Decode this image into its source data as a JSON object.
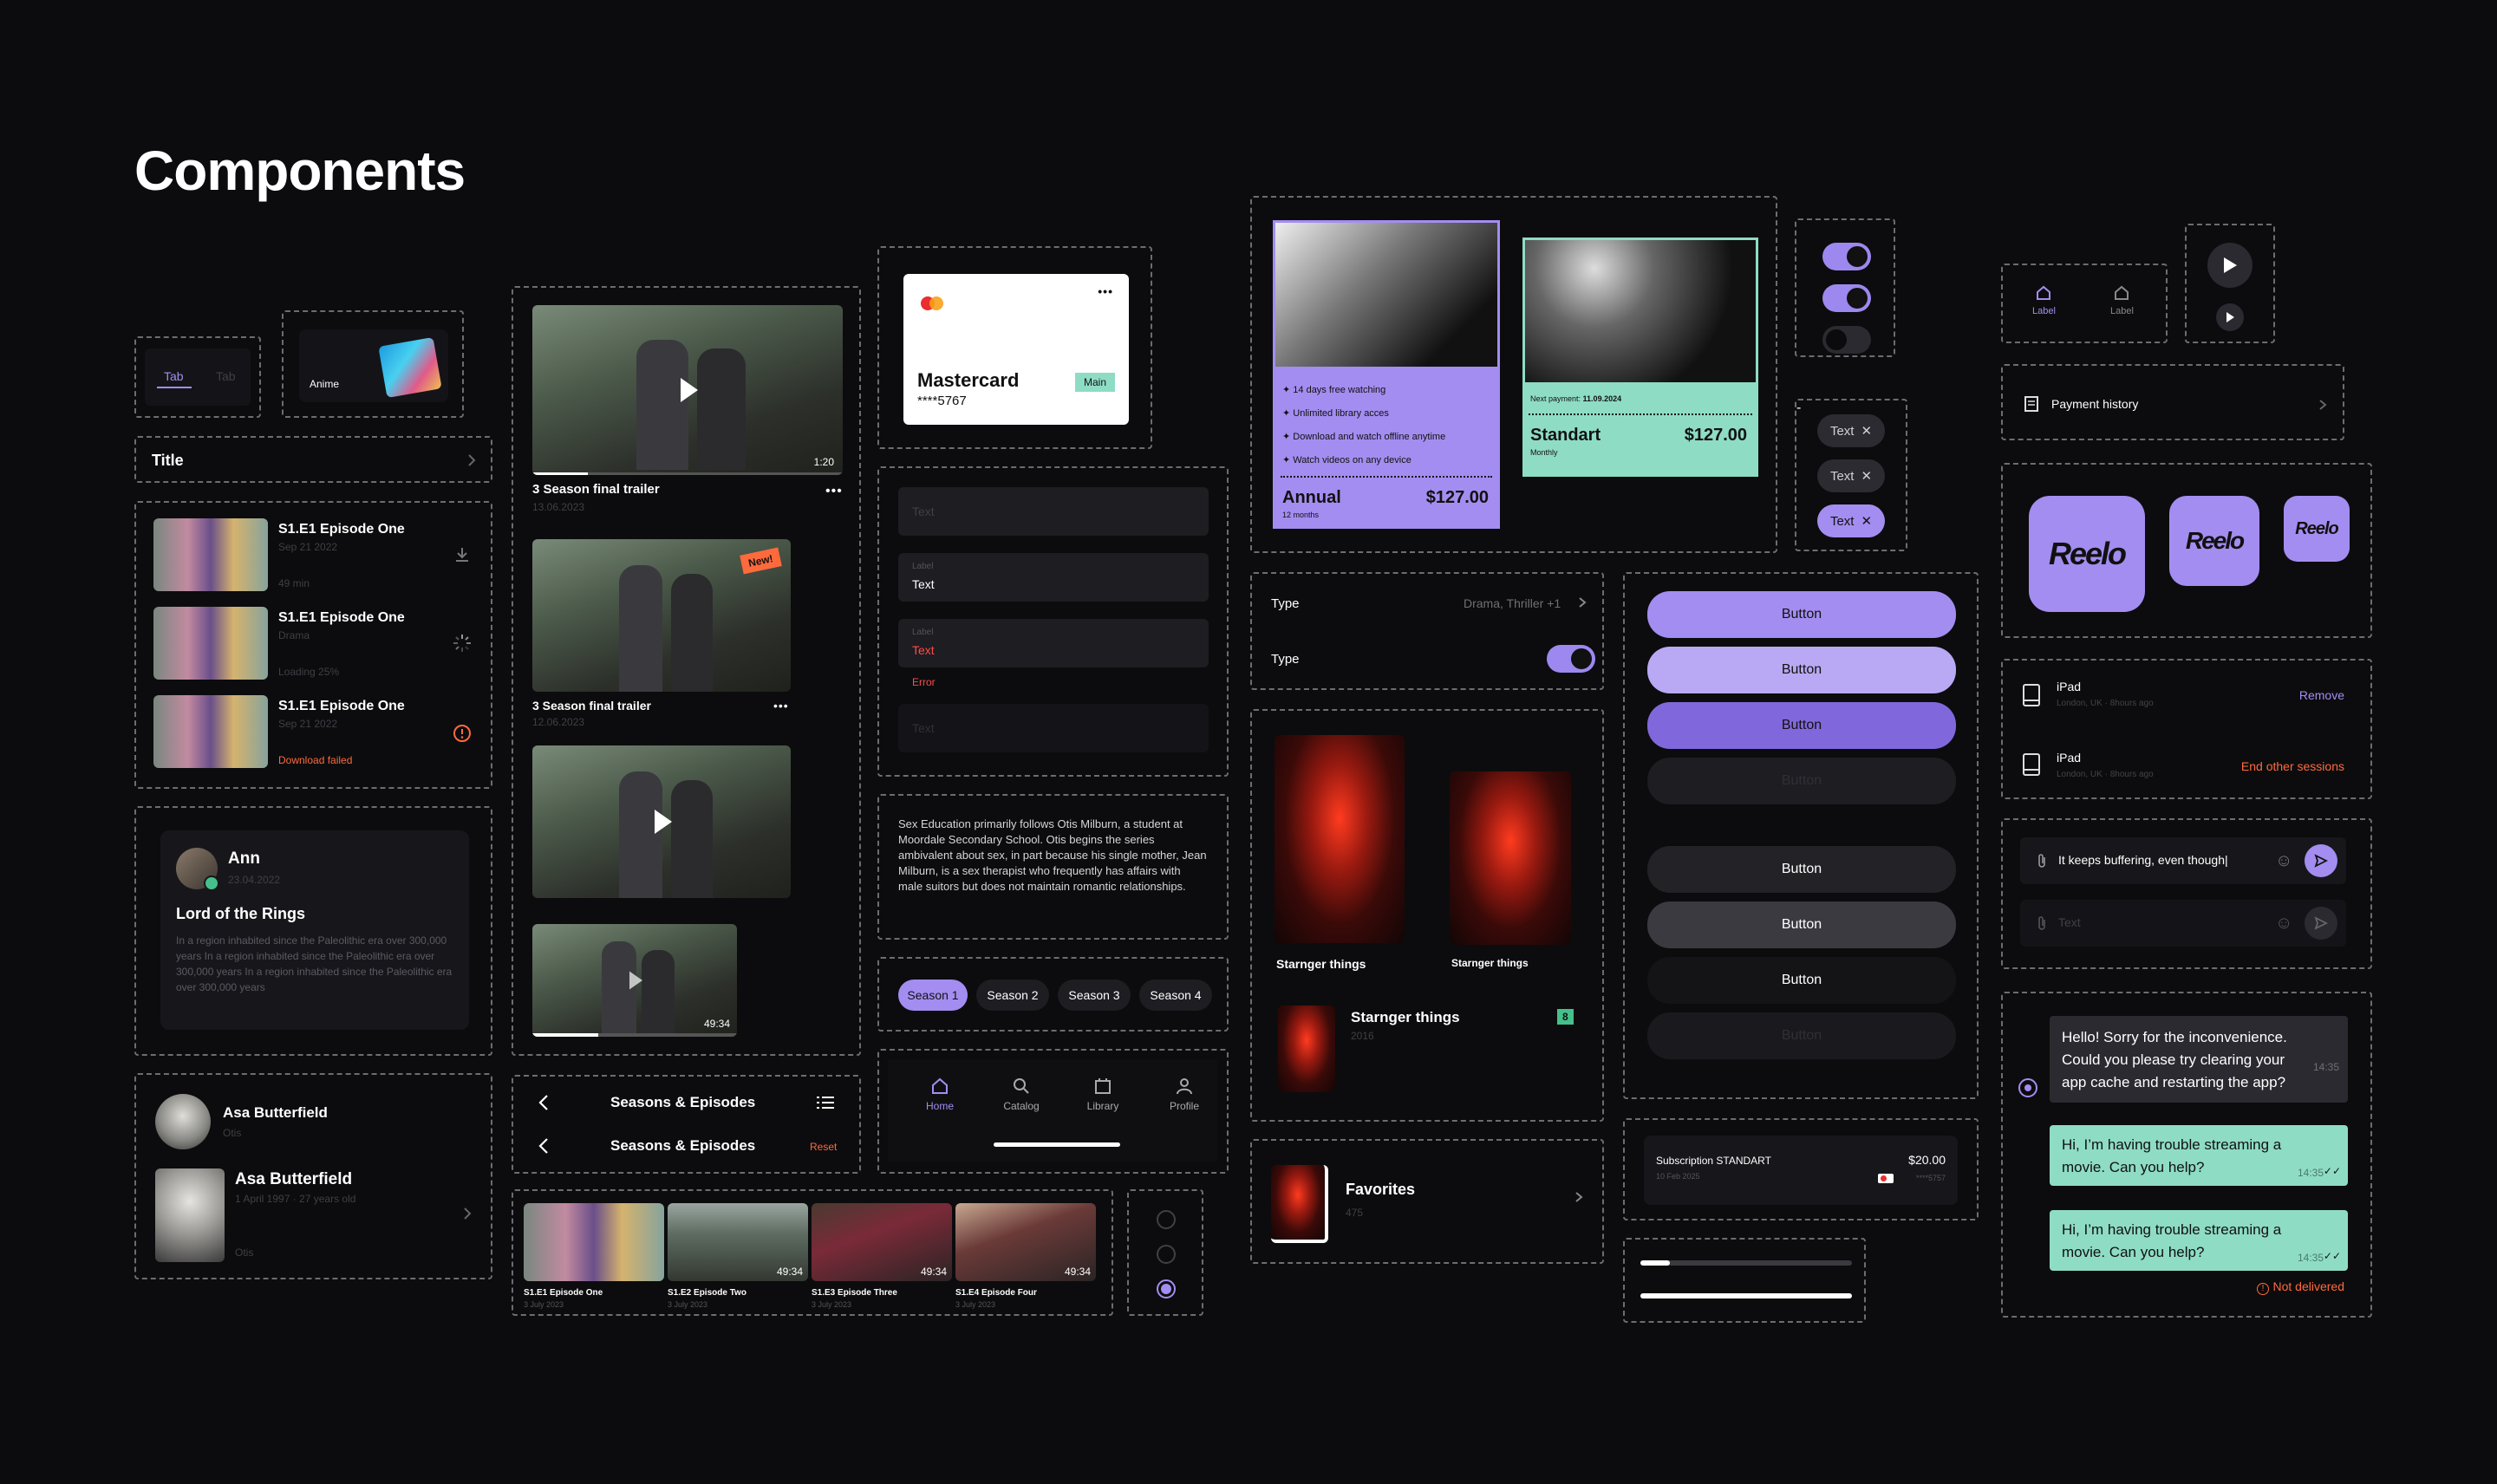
{
  "page": {
    "title": "Components"
  },
  "tabs": {
    "active": "Tab",
    "inactive": "Tab"
  },
  "category_card": {
    "label": "Anime"
  },
  "title_row": {
    "label": "Title"
  },
  "downloads": [
    {
      "title": "S1.E1 Episode One",
      "sub": "Sep 21 2022",
      "meta": "49 min",
      "state": "download"
    },
    {
      "title": "S1.E1 Episode One",
      "sub": "Drama",
      "meta": "Loading 25%",
      "state": "loading"
    },
    {
      "title": "S1.E1 Episode One",
      "sub": "Sep 21 2022",
      "meta": "Download failed",
      "state": "failed"
    }
  ],
  "review": {
    "name": "Ann",
    "date": "23.04.2022",
    "title": "Lord of the Rings",
    "body": "In a region inhabited since the Paleolithic era over 300,000 years In a region inhabited since the Paleolithic era over 300,000 years In a region inhabited since the Paleolithic era over 300,000 years"
  },
  "cast": [
    {
      "name": "Asa Butterfield",
      "role": "Otis"
    },
    {
      "name": "Asa Butterfield",
      "meta": "1 April 1997 · 27 years old",
      "role": "Otis"
    }
  ],
  "videos": [
    {
      "title": "3 Season final trailer",
      "date": "13.06.2023",
      "duration": "1:20"
    },
    {
      "title": "3 Season final trailer",
      "date": "12.06.2023",
      "badge": "New!"
    },
    {
      "duration": "49:34"
    }
  ],
  "payment_card": {
    "brand": "Mastercard",
    "number": "****5767",
    "badge": "Main"
  },
  "inputs": [
    {
      "placeholder": "Text"
    },
    {
      "label": "Label",
      "value": "Text"
    },
    {
      "label": "Label",
      "value": "Text",
      "error": "Error"
    },
    {
      "placeholder": "Text"
    }
  ],
  "description": "Sex Education primarily follows Otis Milburn, a student at Moordale Secondary School. Otis begins the series ambivalent about sex, in part because his single mother, Jean Milburn, is a sex therapist who frequently has affairs with male suitors but does not maintain romantic relationships.",
  "seasons": [
    "Season 1",
    "Season 2",
    "Season 3",
    "Season 4"
  ],
  "bottom_nav": [
    "Home",
    "Catalog",
    "Library",
    "Profile"
  ],
  "seasons_header": {
    "title": "Seasons & Episodes",
    "reset": "Reset"
  },
  "episode_strip": [
    {
      "title": "S1.E1 Episode One",
      "date": "3 July 2023"
    },
    {
      "title": "S1.E2 Episode Two",
      "date": "3 July 2023",
      "duration": "49:34"
    },
    {
      "title": "S1.E3 Episode Three",
      "date": "3 July 2023",
      "duration": "49:34"
    },
    {
      "title": "S1.E4 Episode Four",
      "date": "3 July 2023",
      "duration": "49:34"
    }
  ],
  "plans": {
    "annual": {
      "features": [
        "14 days free watching",
        "Unlimited library acces",
        "Download and watch offline anytime",
        "Watch videos on any device"
      ],
      "name": "Annual",
      "price": "$127.00",
      "period": "12 months"
    },
    "standart": {
      "next_label": "Next payment:",
      "next_date": "11.09.2024",
      "name": "Standart",
      "price": "$127.00",
      "period": "Monthly"
    }
  },
  "filter": {
    "type_label": "Type",
    "type_value": "Drama, Thriller +1",
    "toggle_label": "Type"
  },
  "chips": [
    "Text",
    "Text",
    "Text"
  ],
  "buttons": [
    "Button",
    "Button",
    "Button",
    "Button",
    "Button",
    "Button",
    "Button",
    "Button"
  ],
  "posters": [
    {
      "title": "Starnger things"
    },
    {
      "title": "Starnger things"
    }
  ],
  "poster_row": {
    "title": "Starnger things",
    "year": "2016",
    "rating": "8"
  },
  "favorites": {
    "title": "Favorites",
    "count": "475"
  },
  "subscription": {
    "title": "Subscription STANDART",
    "date": "10 Feb 2025",
    "price": "$20.00",
    "card": "****5757"
  },
  "small_tabs": [
    "Label",
    "Label"
  ],
  "payment_history": {
    "label": "Payment history"
  },
  "logos": [
    "Reelo",
    "Reelo",
    "Reelo"
  ],
  "sessions": [
    {
      "device": "iPad",
      "meta": "London, UK · 8hours ago",
      "action": "Remove"
    },
    {
      "device": "iPad",
      "meta": "London, UK · 8hours ago",
      "action": "End other sessions"
    }
  ],
  "chat_inputs": [
    {
      "value": "It keeps buffering, even though|"
    },
    {
      "placeholder": "Text"
    }
  ],
  "chat": [
    {
      "from": "support",
      "text": "Hello! Sorry for the inconvenience. Could you please try clearing your app cache and restarting the app?",
      "time": "14:35"
    },
    {
      "from": "user",
      "text": "Hi, I’m having trouble streaming a movie. Can you help?",
      "time": "14:35"
    },
    {
      "from": "user",
      "text": "Hi, I’m having trouble streaming a movie. Can you help?",
      "time": "14:35",
      "status": "Not delivered"
    }
  ],
  "colors": {
    "accent": "#a38df0",
    "mint": "#8edcc4",
    "error": "#ff6a3d",
    "bg": "#0c0c0e"
  }
}
